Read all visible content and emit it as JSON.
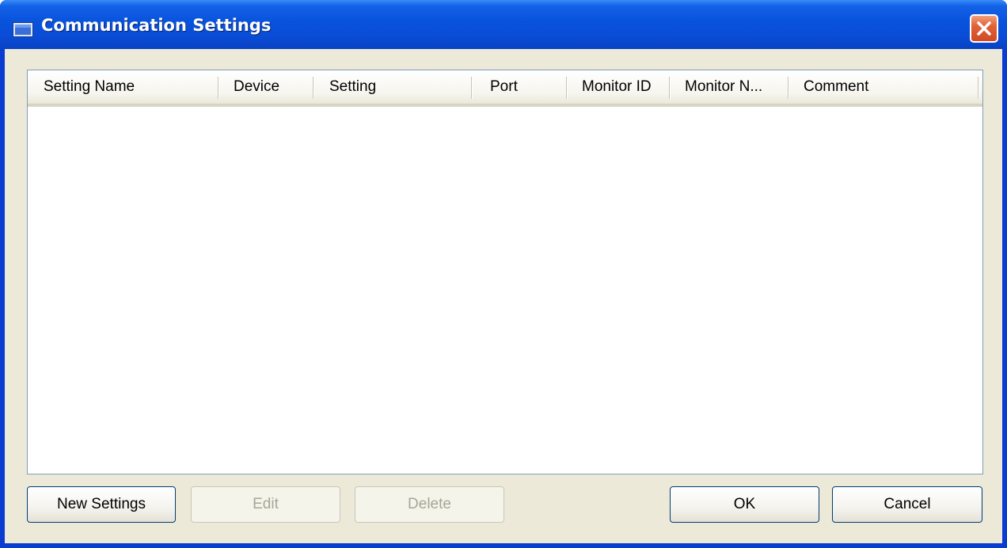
{
  "window": {
    "title": "Communication Settings",
    "icon": "monitor-icon",
    "close_icon": "close-icon"
  },
  "list": {
    "columns": [
      "Setting Name",
      "Device",
      "Setting",
      "Port",
      "Monitor ID",
      "Monitor N...",
      "Comment"
    ],
    "rows": []
  },
  "buttons": {
    "new_settings": "New Settings",
    "edit": "Edit",
    "delete": "Delete",
    "ok": "OK",
    "cancel": "Cancel"
  },
  "colors": {
    "titlebar": "#0a4cd6",
    "dialog_face": "#ece9d8",
    "close_button": "#e0623a"
  }
}
